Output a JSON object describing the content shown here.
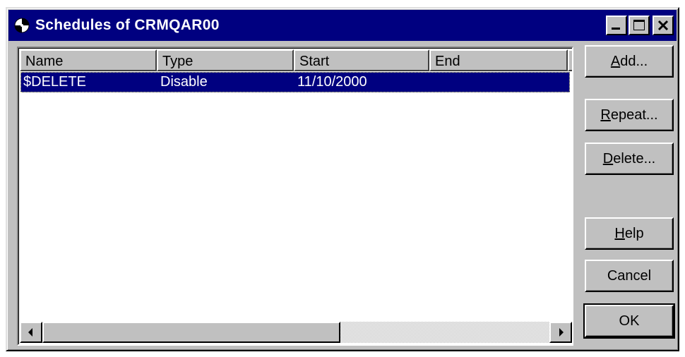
{
  "window": {
    "title": "Schedules of CRMQAR00",
    "icon": "clock-icon"
  },
  "list": {
    "columns": [
      {
        "label": "Name"
      },
      {
        "label": "Type"
      },
      {
        "label": "Start"
      },
      {
        "label": "End"
      },
      {
        "label": ""
      }
    ],
    "rows": [
      {
        "name": "$DELETE",
        "type": "Disable",
        "start": "11/10/2000",
        "end": "",
        "selected": true
      }
    ]
  },
  "buttons": {
    "add": {
      "pre": "",
      "mn": "A",
      "post": "dd..."
    },
    "repeat": {
      "pre": "",
      "mn": "R",
      "post": "epeat..."
    },
    "delete": {
      "pre": "",
      "mn": "D",
      "post": "elete..."
    },
    "help": {
      "pre": "",
      "mn": "H",
      "post": "elp"
    },
    "cancel": {
      "label": "Cancel"
    },
    "ok": {
      "label": "OK"
    }
  }
}
